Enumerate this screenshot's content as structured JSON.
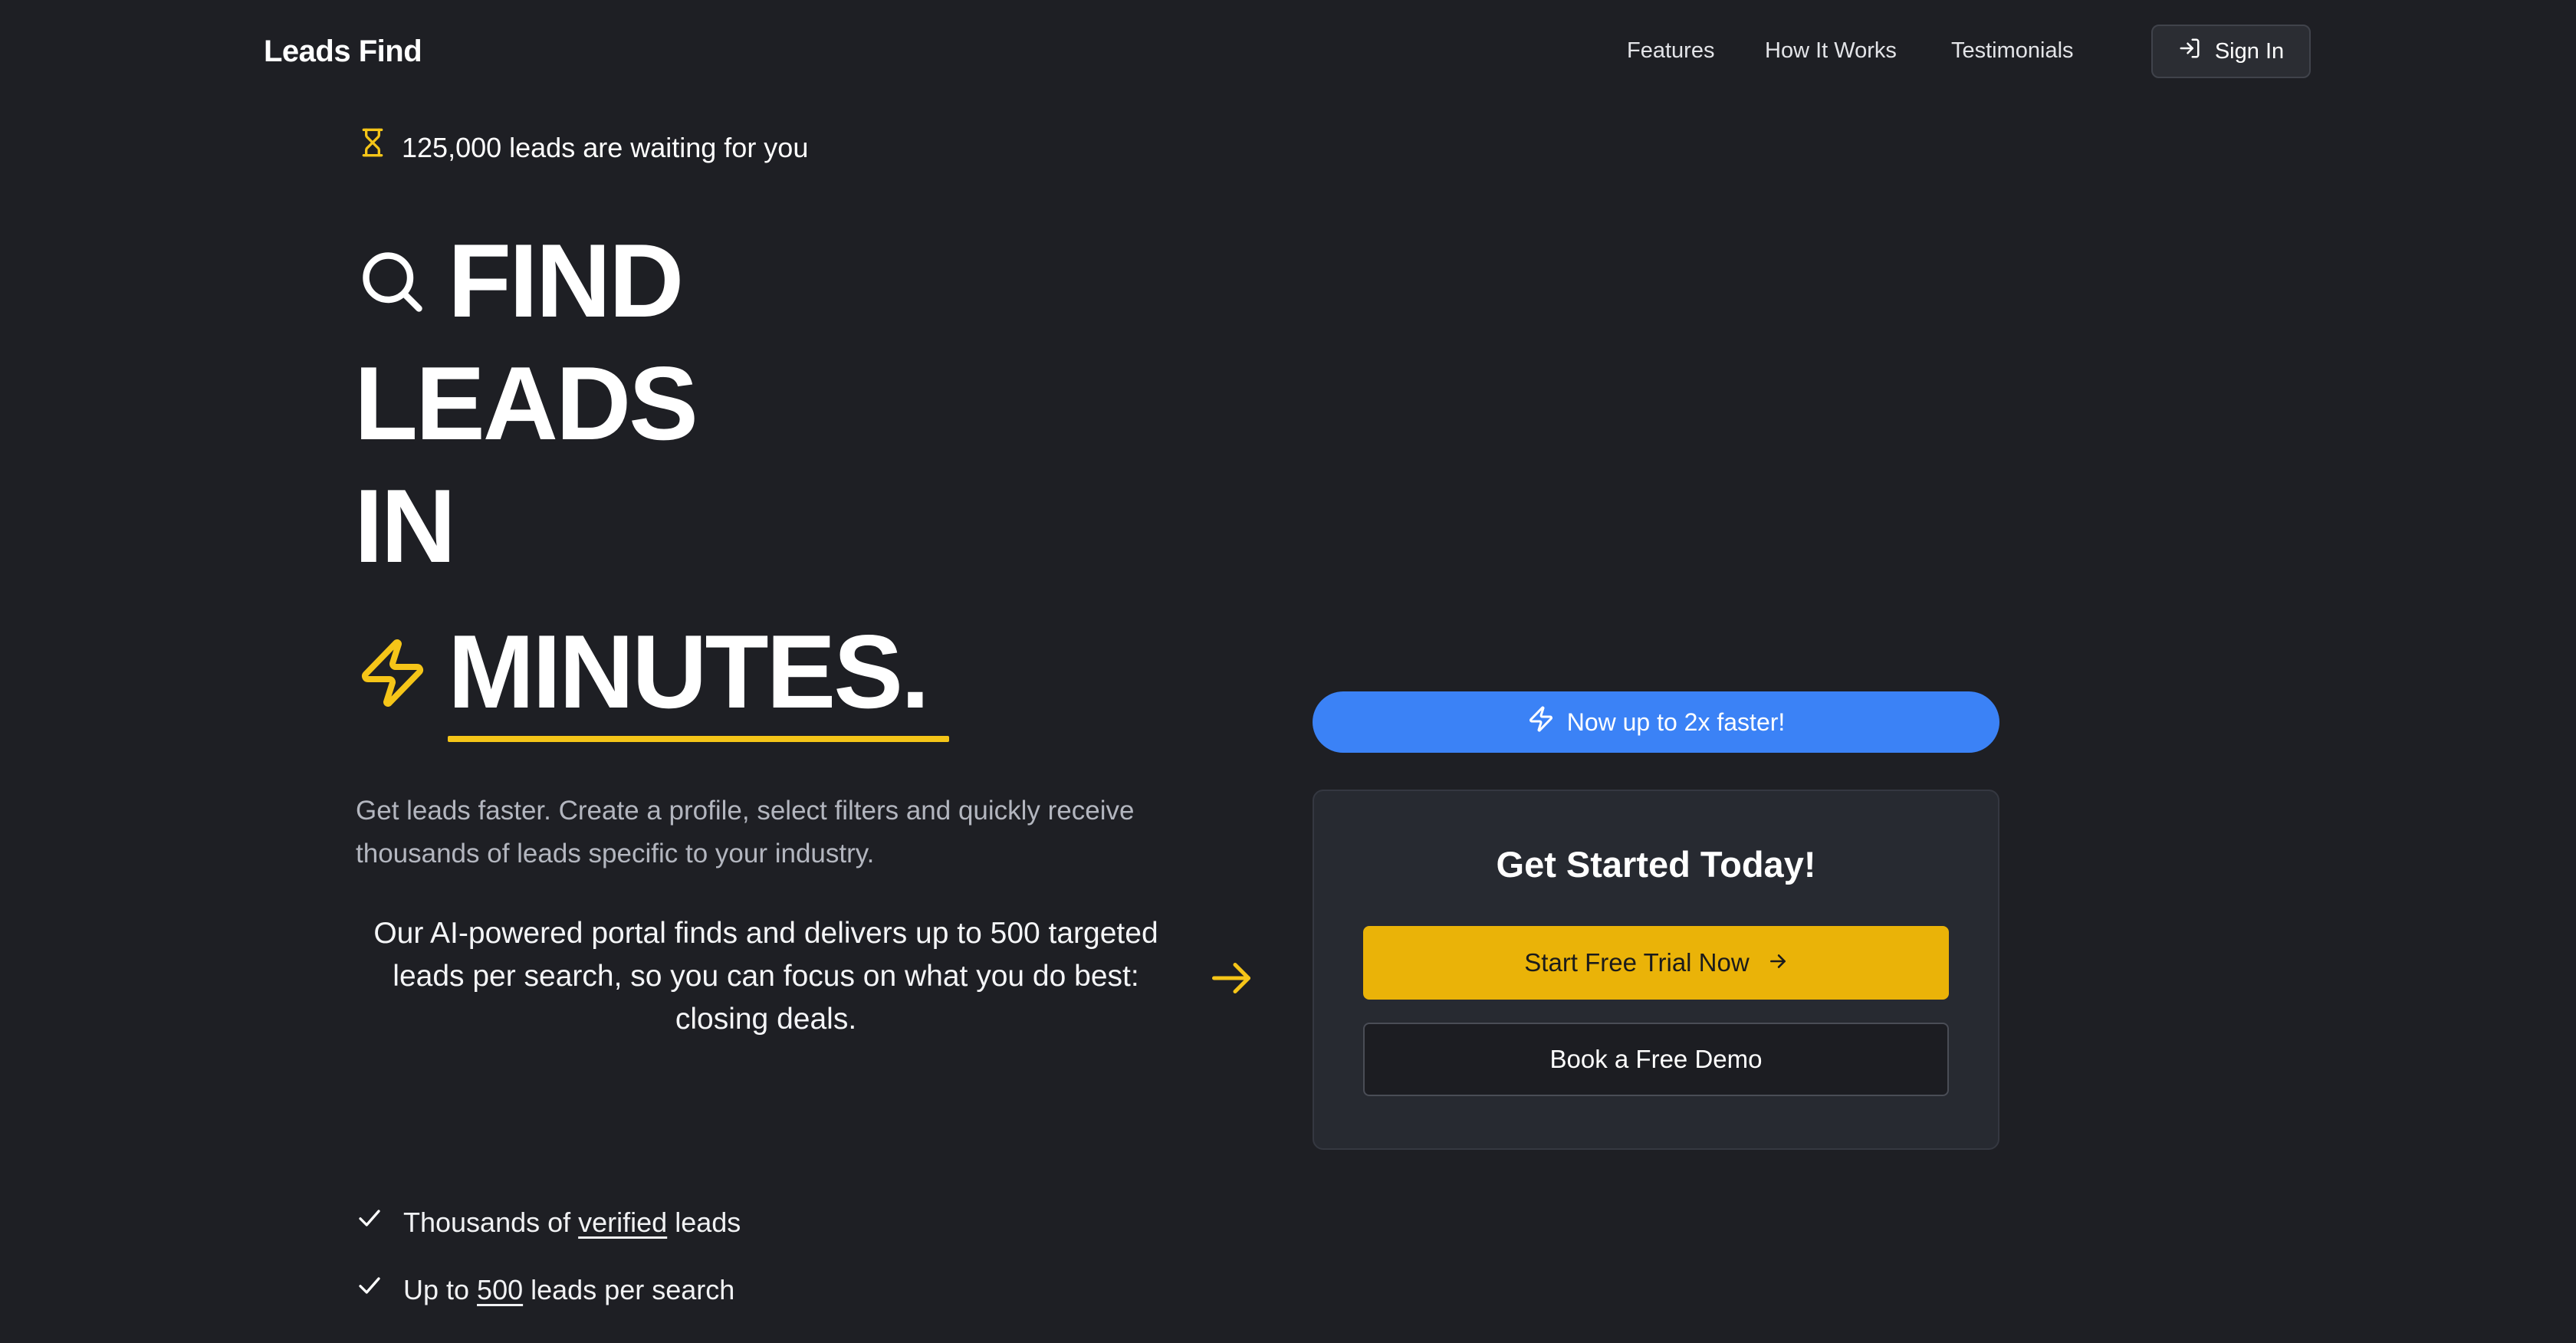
{
  "header": {
    "brand": "Leads Find",
    "nav": [
      "Features",
      "How It Works",
      "Testimonials"
    ],
    "signin_label": "Sign In",
    "signin_icon": "log-in-icon"
  },
  "hero": {
    "waiting_text": "125,000 leads are waiting for you",
    "waiting_icon": "hourglass-icon",
    "headline_find": "FIND",
    "headline_leads": "LEADS",
    "headline_in": "IN",
    "headline_minutes": "MINUTES.",
    "description": "Get leads faster. Create a profile, select filters and quickly receive thousands of leads specific to your industry.",
    "promo": "Our AI-powered portal finds and delivers up to 500 targeted leads per search, so you can focus on what you do best: closing deals.",
    "features": [
      {
        "before": "Thousands of ",
        "highlight": "verified",
        "after": " leads"
      },
      {
        "before": "Up to ",
        "highlight": "500",
        "after": " leads per search"
      }
    ]
  },
  "signup": {
    "speed_label": "Now up to 2x faster!",
    "title": "Get Started Today!",
    "trial_label": "Start Free Trial Now",
    "demo_label": "Book a Free Demo"
  },
  "colors": {
    "background": "#1e1f24",
    "accent_yellow": "#eab308",
    "accent_blue": "#3b82f6",
    "card": "#272a31"
  }
}
